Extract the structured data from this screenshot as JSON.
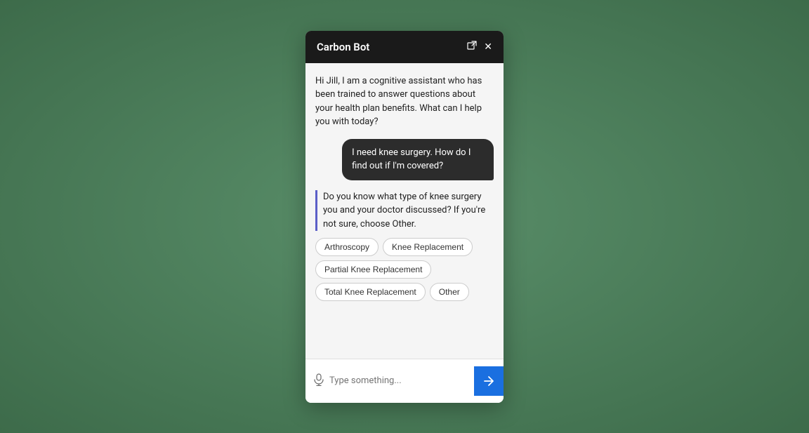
{
  "header": {
    "title": "Carbon Bot",
    "external_link_icon": "↗",
    "close_icon": "✕"
  },
  "messages": [
    {
      "type": "bot",
      "text": "Hi Jill, I am a cognitive assistant who has been trained to answer questions about your health plan benefits. What can I help you with today?",
      "withBorder": false
    },
    {
      "type": "user",
      "text": "I need knee surgery. How do I find out if I'm covered?"
    },
    {
      "type": "bot",
      "text": "Do you know what type of knee surgery you and your doctor discussed? If you're not sure, choose Other.",
      "withBorder": true
    }
  ],
  "chips": [
    {
      "label": "Arthroscopy"
    },
    {
      "label": "Knee Replacement"
    },
    {
      "label": "Partial Knee Replacement"
    },
    {
      "label": "Total Knee Replacement"
    },
    {
      "label": "Other"
    }
  ],
  "input": {
    "placeholder": "Type something...",
    "send_icon": "→"
  }
}
